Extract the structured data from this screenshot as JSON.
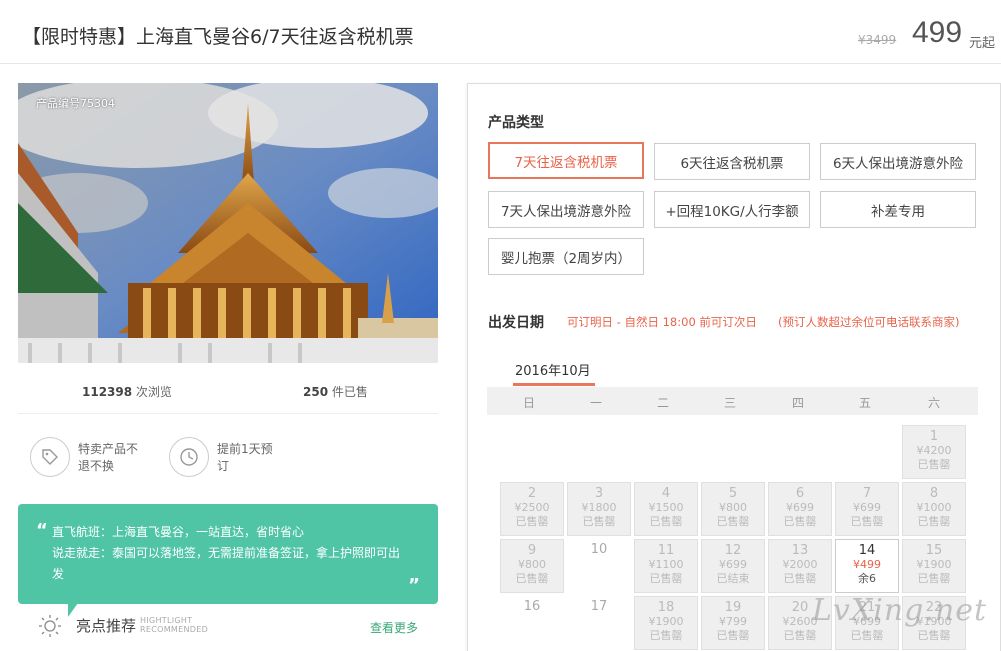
{
  "header": {
    "title": "【限时特惠】上海直飞曼谷6/7天往返含税机票",
    "old_price": "¥3499",
    "price": "499",
    "price_unit": "元起"
  },
  "hero": {
    "code": "产品编号75304"
  },
  "stats": {
    "views_num": "112398",
    "views_label": " 次浏览",
    "sold_num": "250",
    "sold_label": " 件已售"
  },
  "features": [
    {
      "line1": "特卖产品不",
      "line2": "退不换"
    },
    {
      "line1": "提前1天预",
      "line2": "订"
    }
  ],
  "intro": {
    "line1": "直飞航班：上海直飞曼谷，一站直达，省时省心",
    "line2": "说走就走：泰国可以落地签，无需提前准备签证，拿上护照即可出",
    "line3": "发"
  },
  "highlight": {
    "title": "亮点推荐",
    "en1": "HIGHTLIGHT",
    "en2": "RECOMMENDED",
    "more": "查看更多"
  },
  "product_type": {
    "label": "产品类型",
    "options": [
      "7天往返含税机票",
      "6天往返含税机票",
      "6天人保出境游意外险",
      "7天人保出境游意外险",
      "+回程10KG/人行李额",
      "补差专用",
      "婴儿抱票（2周岁内）"
    ]
  },
  "departure": {
    "label": "出发日期",
    "note1": "可订明日 - 自然日 18:00 前可订次日",
    "note2": "(预订人数超过余位可电话联系商家)"
  },
  "calendar": {
    "month": "2016年10月",
    "weekdays": [
      "日",
      "一",
      "二",
      "三",
      "四",
      "五",
      "六"
    ],
    "days": [
      {
        "d": "1",
        "p": "¥4200",
        "s": "已售罄",
        "t": "sold"
      },
      {
        "d": "2",
        "p": "¥2500",
        "s": "已售罄",
        "t": "sold"
      },
      {
        "d": "3",
        "p": "¥1800",
        "s": "已售罄",
        "t": "sold"
      },
      {
        "d": "4",
        "p": "¥1500",
        "s": "已售罄",
        "t": "sold"
      },
      {
        "d": "5",
        "p": "¥800",
        "s": "已售罄",
        "t": "sold"
      },
      {
        "d": "6",
        "p": "¥699",
        "s": "已售罄",
        "t": "sold"
      },
      {
        "d": "7",
        "p": "¥699",
        "s": "已售罄",
        "t": "sold"
      },
      {
        "d": "8",
        "p": "¥1000",
        "s": "已售罄",
        "t": "sold"
      },
      {
        "d": "9",
        "p": "¥800",
        "s": "已售罄",
        "t": "sold"
      },
      {
        "d": "10",
        "p": "",
        "s": "",
        "t": "plain"
      },
      {
        "d": "11",
        "p": "¥1100",
        "s": "已售罄",
        "t": "sold"
      },
      {
        "d": "12",
        "p": "¥699",
        "s": "已结束",
        "t": "sold"
      },
      {
        "d": "13",
        "p": "¥2000",
        "s": "已售罄",
        "t": "sold"
      },
      {
        "d": "14",
        "p": "¥499",
        "s": "余6",
        "t": "open"
      },
      {
        "d": "15",
        "p": "¥1900",
        "s": "已售罄",
        "t": "sold"
      },
      {
        "d": "16",
        "p": "",
        "s": "",
        "t": "plain"
      },
      {
        "d": "17",
        "p": "",
        "s": "",
        "t": "plain"
      },
      {
        "d": "18",
        "p": "¥1900",
        "s": "已售罄",
        "t": "sold"
      },
      {
        "d": "19",
        "p": "¥799",
        "s": "已售罄",
        "t": "sold"
      },
      {
        "d": "20",
        "p": "¥2600",
        "s": "已售罄",
        "t": "sold"
      },
      {
        "d": "21",
        "p": "¥699",
        "s": "已售罄",
        "t": "sold"
      },
      {
        "d": "22",
        "p": "¥1900",
        "s": "已售罄",
        "t": "sold"
      }
    ]
  },
  "watermark": "LvXing.net",
  "colors": {
    "accent": "#e8634a",
    "green": "#4fc5a6"
  }
}
